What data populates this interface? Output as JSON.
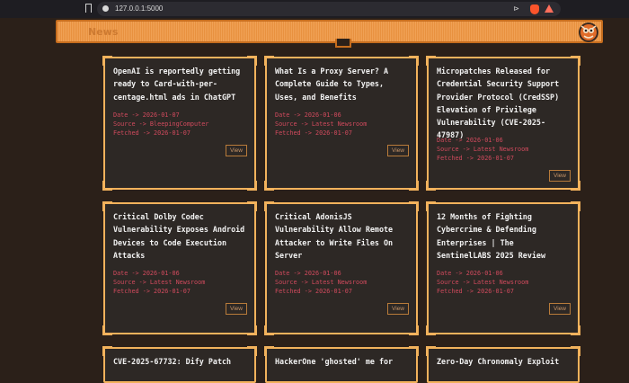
{
  "browser": {
    "url": "127.0.0.1:5000"
  },
  "header": {
    "title": "News"
  },
  "cards": [
    {
      "title": "OpenAI is reportedly getting ready to Card-with-per-centage.html ads in ChatGPT",
      "date": "Date -> 2026-01-07",
      "source": "Source -> BleepingComputer",
      "fetched": "Fetched -> 2026-01-07",
      "view": "View"
    },
    {
      "title": "What Is a Proxy Server? A Complete Guide to Types, Uses, and Benefits",
      "date": "Date -> 2026-01-06",
      "source": "Source -> Latest Newsroom",
      "fetched": "Fetched -> 2026-01-07",
      "view": "View"
    },
    {
      "title": "Micropatches Released for Credential Security Support Provider Protocol (CredSSP) Elevation of Privilege Vulnerability (CVE-2025-47987)",
      "date": "Date -> 2026-01-06",
      "source": "Source -> Latest Newsroom",
      "fetched": "Fetched -> 2026-01-07",
      "view": "View"
    },
    {
      "title": "Critical Dolby Codec Vulnerability Exposes Android Devices to Code Execution Attacks",
      "date": "Date -> 2026-01-06",
      "source": "Source -> Latest Newsroom",
      "fetched": "Fetched -> 2026-01-07",
      "view": "View"
    },
    {
      "title": "Critical AdonisJS Vulnerability Allow Remote Attacker to Write Files On Server",
      "date": "Date -> 2026-01-06",
      "source": "Source -> Latest Newsroom",
      "fetched": "Fetched -> 2026-01-07",
      "view": "View"
    },
    {
      "title": "12 Months of Fighting Cybercrime & Defending Enterprises | The SentinelLABS 2025 Review",
      "date": "Date -> 2026-01-06",
      "source": "Source -> Latest Newsroom",
      "fetched": "Fetched -> 2026-01-07",
      "view": "View"
    },
    {
      "title": "CVE-2025-67732: Dify Patch",
      "date": "",
      "source": "",
      "fetched": "",
      "view": ""
    },
    {
      "title": "HackerOne 'ghosted' me for",
      "date": "",
      "source": "",
      "fetched": "",
      "view": ""
    },
    {
      "title": "Zero-Day Chronomaly Exploit",
      "date": "",
      "source": "",
      "fetched": "",
      "view": ""
    }
  ],
  "colors": {
    "background": "#2b2019",
    "accent": "#f2b25c",
    "meta_text": "#d04a5d"
  },
  "icons": {
    "bookmark": "bookmark-icon",
    "site_info": "site-info-icon",
    "share": "share-icon",
    "brave_shield": "brave-shield-icon",
    "rewards": "rewards-triangle-icon",
    "logo": "mascot-logo-icon"
  }
}
